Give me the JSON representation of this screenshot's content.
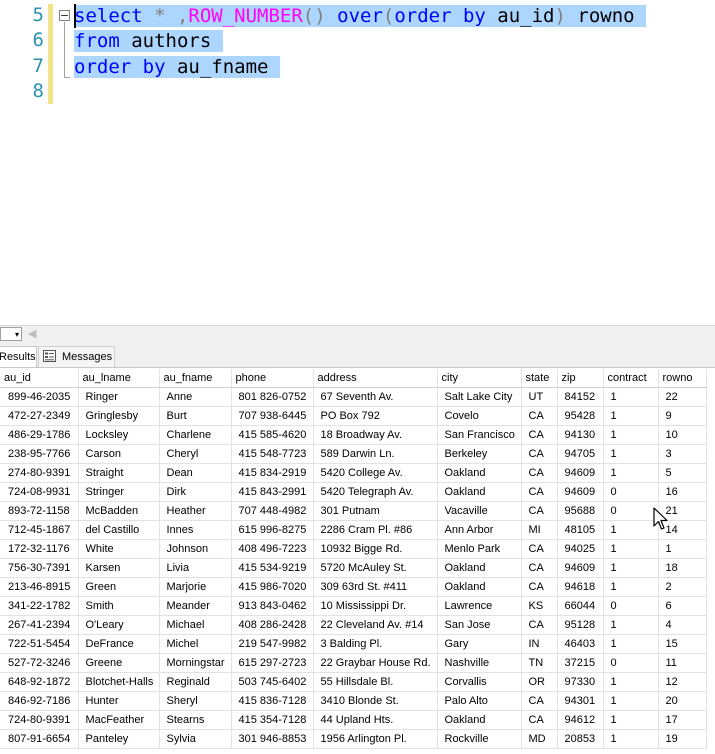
{
  "editor": {
    "line_numbers": [
      "5",
      "6",
      "7",
      "8"
    ],
    "line1": {
      "select": "select",
      "star": " * ,",
      "row_number": "ROW_NUMBER",
      "paren": "()",
      "over": " over",
      "open": "(",
      "order_by": "order by",
      "au_id": " au_id",
      "close": ")",
      "alias": " rowno"
    },
    "line2": {
      "from": "from",
      "table": " authors"
    },
    "line3": {
      "order_by": "order by",
      "col": " au_fname"
    }
  },
  "results": {
    "zoom_value": "▾",
    "tabs": {
      "results": "Results",
      "messages": "Messages"
    },
    "columns": [
      "au_id",
      "au_lname",
      "au_fname",
      "phone",
      "address",
      "city",
      "state",
      "zip",
      "contract",
      "rowno"
    ],
    "rows": [
      [
        "899-46-2035",
        "Ringer",
        "Anne",
        "801 826-0752",
        "67 Seventh Av.",
        "Salt Lake City",
        "UT",
        "84152",
        "1",
        "22"
      ],
      [
        "472-27-2349",
        "Gringlesby",
        "Burt",
        "707 938-6445",
        "PO Box 792",
        "Covelo",
        "CA",
        "95428",
        "1",
        "9"
      ],
      [
        "486-29-1786",
        "Locksley",
        "Charlene",
        "415 585-4620",
        "18 Broadway Av.",
        "San Francisco",
        "CA",
        "94130",
        "1",
        "10"
      ],
      [
        "238-95-7766",
        "Carson",
        "Cheryl",
        "415 548-7723",
        "589 Darwin Ln.",
        "Berkeley",
        "CA",
        "94705",
        "1",
        "3"
      ],
      [
        "274-80-9391",
        "Straight",
        "Dean",
        "415 834-2919",
        "5420 College Av.",
        "Oakland",
        "CA",
        "94609",
        "1",
        "5"
      ],
      [
        "724-08-9931",
        "Stringer",
        "Dirk",
        "415 843-2991",
        "5420 Telegraph Av.",
        "Oakland",
        "CA",
        "94609",
        "0",
        "16"
      ],
      [
        "893-72-1158",
        "McBadden",
        "Heather",
        "707 448-4982",
        "301 Putnam",
        "Vacaville",
        "CA",
        "95688",
        "0",
        "21"
      ],
      [
        "712-45-1867",
        "del Castillo",
        "Innes",
        "615 996-8275",
        "2286 Cram Pl. #86",
        "Ann Arbor",
        "MI",
        "48105",
        "1",
        "14"
      ],
      [
        "172-32-1176",
        "White",
        "Johnson",
        "408 496-7223",
        "10932 Bigge Rd.",
        "Menlo Park",
        "CA",
        "94025",
        "1",
        "1"
      ],
      [
        "756-30-7391",
        "Karsen",
        "Livia",
        "415 534-9219",
        "5720 McAuley St.",
        "Oakland",
        "CA",
        "94609",
        "1",
        "18"
      ],
      [
        "213-46-8915",
        "Green",
        "Marjorie",
        "415 986-7020",
        "309 63rd St. #411",
        "Oakland",
        "CA",
        "94618",
        "1",
        "2"
      ],
      [
        "341-22-1782",
        "Smith",
        "Meander",
        "913 843-0462",
        "10 Mississippi Dr.",
        "Lawrence",
        "KS",
        "66044",
        "0",
        "6"
      ],
      [
        "267-41-2394",
        "O'Leary",
        "Michael",
        "408 286-2428",
        "22 Cleveland Av. #14",
        "San Jose",
        "CA",
        "95128",
        "1",
        "4"
      ],
      [
        "722-51-5454",
        "DeFrance",
        "Michel",
        "219 547-9982",
        "3 Balding Pl.",
        "Gary",
        "IN",
        "46403",
        "1",
        "15"
      ],
      [
        "527-72-3246",
        "Greene",
        "Morningstar",
        "615 297-2723",
        "22 Graybar House Rd.",
        "Nashville",
        "TN",
        "37215",
        "0",
        "11"
      ],
      [
        "648-92-1872",
        "Blotchet-Halls",
        "Reginald",
        "503 745-6402",
        "55 Hillsdale Bl.",
        "Corvallis",
        "OR",
        "97330",
        "1",
        "12"
      ],
      [
        "846-92-7186",
        "Hunter",
        "Sheryl",
        "415 836-7128",
        "3410 Blonde St.",
        "Palo Alto",
        "CA",
        "94301",
        "1",
        "20"
      ],
      [
        "724-80-9391",
        "MacFeather",
        "Stearns",
        "415 354-7128",
        "44 Upland Hts.",
        "Oakland",
        "CA",
        "94612",
        "1",
        "17"
      ],
      [
        "807-91-6654",
        "Panteley",
        "Sylvia",
        "301 946-8853",
        "1956 Arlington Pl.",
        "Rockville",
        "MD",
        "20853",
        "1",
        "19"
      ]
    ]
  }
}
